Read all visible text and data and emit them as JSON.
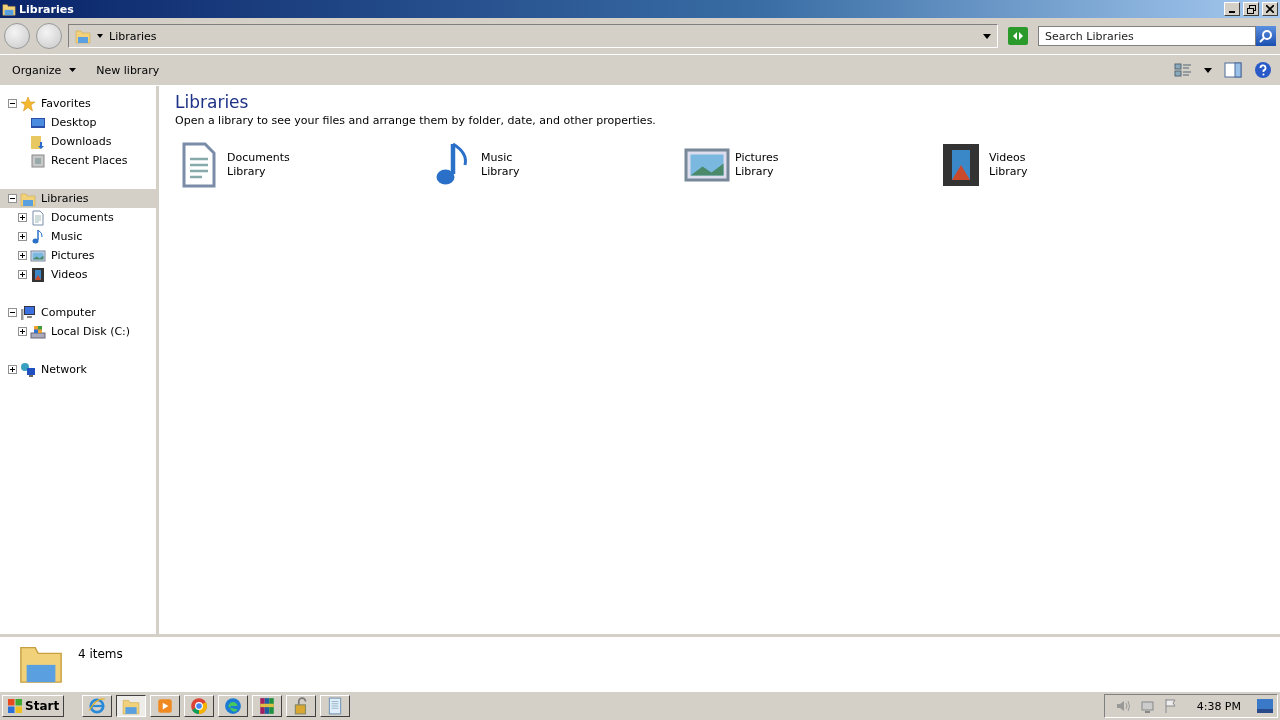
{
  "window": {
    "title": "Libraries"
  },
  "address": {
    "path": "Libraries"
  },
  "search": {
    "placeholder": "Search Libraries"
  },
  "toolbar": {
    "buttons": [
      {
        "label": "Organize",
        "dropdown": true
      },
      {
        "label": "New library",
        "dropdown": false
      }
    ]
  },
  "tree": [
    {
      "label": "Favorites",
      "kind": "star",
      "expanded": true,
      "selected": false,
      "children": [
        {
          "label": "Desktop",
          "kind": "desktop",
          "selected": false
        },
        {
          "label": "Downloads",
          "kind": "downloads",
          "selected": false
        },
        {
          "label": "Recent Places",
          "kind": "recent",
          "selected": false
        }
      ]
    },
    {
      "label": "Libraries",
      "kind": "library",
      "expanded": true,
      "selected": true,
      "children": [
        {
          "label": "Documents",
          "kind": "documents",
          "expanded": false,
          "selected": false
        },
        {
          "label": "Music",
          "kind": "music",
          "expanded": false,
          "selected": false
        },
        {
          "label": "Pictures",
          "kind": "pictures",
          "expanded": false,
          "selected": false
        },
        {
          "label": "Videos",
          "kind": "videos",
          "expanded": false,
          "selected": false
        }
      ]
    },
    {
      "label": "Computer",
      "kind": "computer",
      "expanded": true,
      "selected": false,
      "children": [
        {
          "label": "Local Disk (C:)",
          "kind": "disk",
          "expanded": false,
          "selected": false
        }
      ]
    },
    {
      "label": "Network",
      "kind": "network",
      "expanded": false,
      "selected": false
    }
  ],
  "content": {
    "title": "Libraries",
    "subtitle": "Open a library to see your files and arrange them by folder, date, and other properties.",
    "libraries": [
      {
        "name": "Documents",
        "type": "Library",
        "kind": "documents"
      },
      {
        "name": "Music",
        "type": "Library",
        "kind": "music"
      },
      {
        "name": "Pictures",
        "type": "Library",
        "kind": "pictures"
      },
      {
        "name": "Videos",
        "type": "Library",
        "kind": "videos"
      }
    ]
  },
  "details": {
    "count": "4 items"
  },
  "taskbar": {
    "start": "Start",
    "apps": [
      {
        "kind": "ie",
        "active": false
      },
      {
        "kind": "explorer",
        "active": true
      },
      {
        "kind": "media",
        "active": false
      },
      {
        "kind": "chrome",
        "active": false
      },
      {
        "kind": "edge",
        "active": false
      },
      {
        "kind": "winrar",
        "active": false
      },
      {
        "kind": "lock",
        "active": false
      },
      {
        "kind": "notepad",
        "active": false
      }
    ],
    "clock": "4:38 PM"
  }
}
